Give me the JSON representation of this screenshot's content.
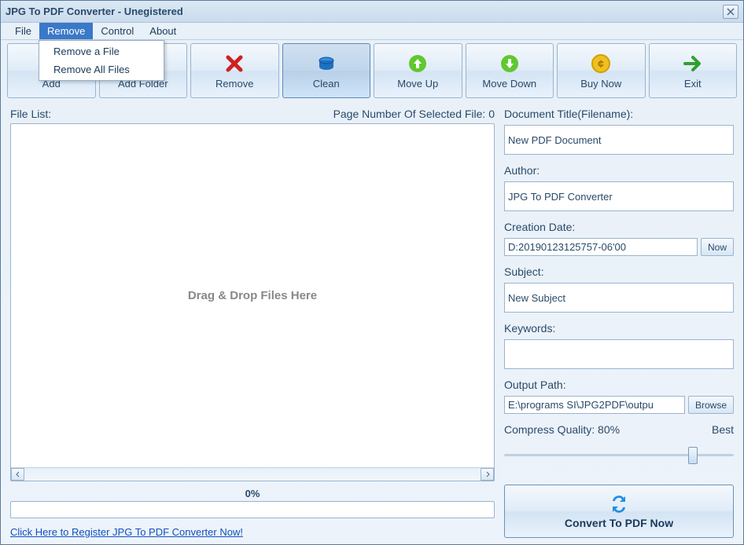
{
  "window": {
    "title": "JPG To PDF Converter - Unegistered"
  },
  "menubar": {
    "items": [
      "File",
      "Remove",
      "Control",
      "About"
    ],
    "active_index": 1,
    "dropdown": {
      "items": [
        "Remove a File",
        "Remove All Files"
      ]
    }
  },
  "toolbar": {
    "buttons": [
      {
        "label": "Add",
        "icon": "plus-icon"
      },
      {
        "label": "Add Folder",
        "icon": "folder-icon"
      },
      {
        "label": "Remove",
        "icon": "x-icon"
      },
      {
        "label": "Clean",
        "icon": "clean-icon",
        "pressed": true
      },
      {
        "label": "Move Up",
        "icon": "up-icon"
      },
      {
        "label": "Move Down",
        "icon": "down-icon"
      },
      {
        "label": "Buy Now",
        "icon": "coin-icon"
      },
      {
        "label": "Exit",
        "icon": "exit-icon"
      }
    ]
  },
  "left": {
    "file_list_label": "File List:",
    "page_number_label": "Page Number Of Selected File: 0",
    "dropzone_text": "Drag & Drop Files Here",
    "progress_text": "0%",
    "register_link": "Click Here to Register JPG To PDF Converter Now!"
  },
  "right": {
    "title_label": "Document Title(Filename):",
    "title_value": "New PDF Document",
    "author_label": "Author:",
    "author_value": "JPG To PDF Converter",
    "date_label": "Creation Date:",
    "date_value": "D:20190123125757-06'00",
    "now_label": "Now",
    "subject_label": "Subject:",
    "subject_value": "New Subject",
    "keywords_label": "Keywords:",
    "keywords_value": "",
    "output_label": "Output Path:",
    "output_value": "E:\\programs SI\\JPG2PDF\\outpu",
    "browse_label": "Browse",
    "quality_label": "Compress Quality: 80%",
    "quality_best": "Best",
    "quality_percent": 80,
    "convert_label": "Convert To PDF Now"
  },
  "colors": {
    "accent": "#3a78c8",
    "text": "#2a4a6a",
    "border": "#9ab4ce"
  }
}
